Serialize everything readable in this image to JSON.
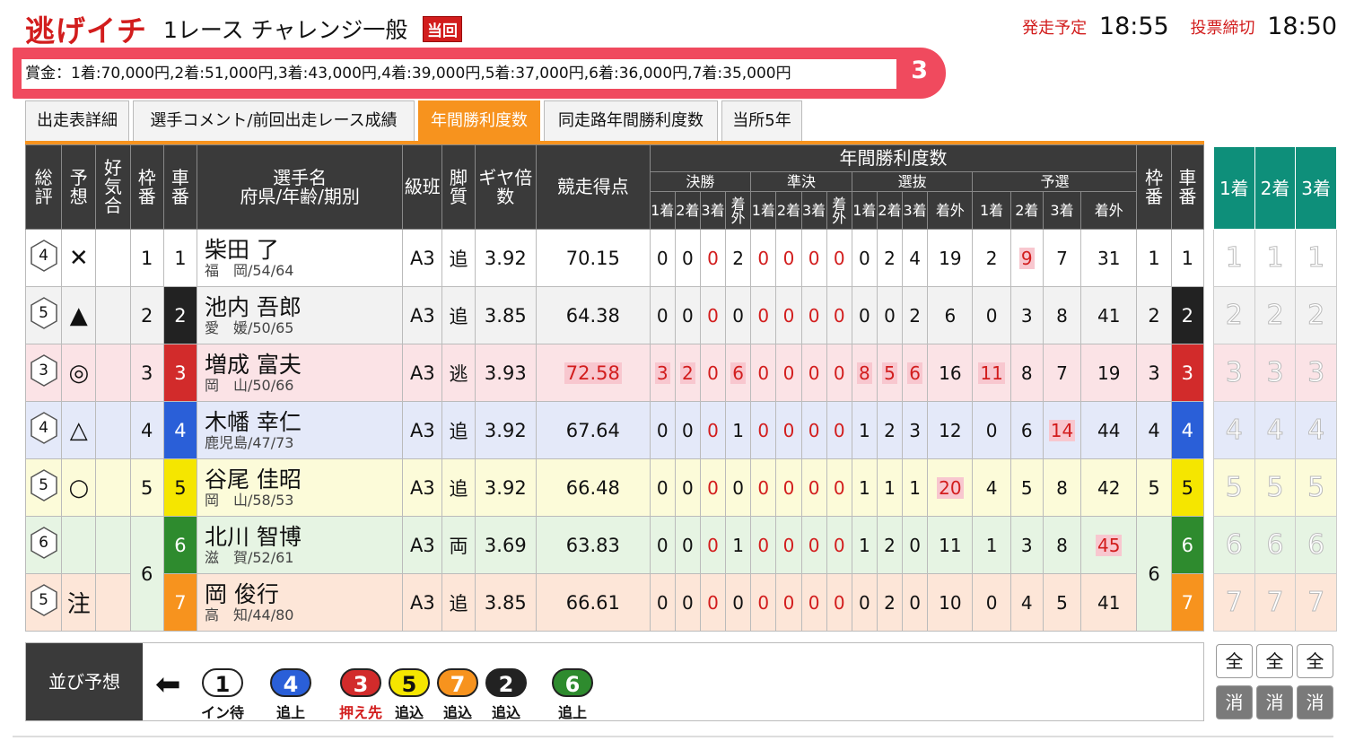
{
  "header": {
    "brand": "逃げイチ",
    "race": "1レース チャレンジ一般",
    "badge": "当回",
    "start_label": "発走予定",
    "start_time": "18:55",
    "close_label": "投票締切",
    "close_time": "18:50"
  },
  "prize": {
    "text": "賞金：1着:70,000円,2着:51,000円,3着:43,000円,4着:39,000円,5着:37,000円,6着:36,000円,7着:35,000円",
    "marker": "3"
  },
  "tabs": [
    "出走表詳細",
    "選手コメント/前回出走レース成績",
    "年間勝利度数",
    "同走路年間勝利度数",
    "当所5年"
  ],
  "table": {
    "headers": {
      "sougou": "総評",
      "yosou": "予想",
      "koukiai": "好気合",
      "waku": "枠番",
      "sha": "車番",
      "name1": "選手名",
      "name2": "府県/年齢/期別",
      "kyu": "級班",
      "kyaku": "脚質",
      "gear": "ギヤ倍数",
      "score": "競走得点",
      "annual": "年間勝利度数",
      "kessho": "決勝",
      "junketsu": "準決",
      "senbatsu": "選抜",
      "yosen": "予選",
      "p1": "1着",
      "p2": "2着",
      "p3": "3着",
      "pout": "着外"
    },
    "rows": [
      {
        "rank": "4",
        "mark": "✕",
        "waku": "1",
        "sha": "1",
        "name": "柴田 了",
        "sub": "福　岡/54/64",
        "kyu": "A3",
        "kyaku": "追",
        "gear": "3.92",
        "score": "70.15",
        "k": [
          "0",
          "0",
          "0",
          "2"
        ],
        "j": [
          "0",
          "0",
          "0",
          "0"
        ],
        "s": [
          "0",
          "2",
          "4",
          "19"
        ],
        "y": [
          "2",
          "9",
          "7",
          "31"
        ]
      },
      {
        "rank": "5",
        "mark": "▲",
        "waku": "2",
        "sha": "2",
        "name": "池内 吾郎",
        "sub": "愛　媛/50/65",
        "kyu": "A3",
        "kyaku": "追",
        "gear": "3.85",
        "score": "64.38",
        "k": [
          "0",
          "0",
          "0",
          "0"
        ],
        "j": [
          "0",
          "0",
          "0",
          "0"
        ],
        "s": [
          "0",
          "0",
          "2",
          "6"
        ],
        "y": [
          "0",
          "3",
          "8",
          "41"
        ]
      },
      {
        "rank": "3",
        "mark": "◎",
        "waku": "3",
        "sha": "3",
        "name": "増成 富夫",
        "sub": "岡　山/50/66",
        "kyu": "A3",
        "kyaku": "逃",
        "gear": "3.93",
        "score": "72.58",
        "k": [
          "3",
          "2",
          "0",
          "6"
        ],
        "j": [
          "0",
          "0",
          "0",
          "0"
        ],
        "s": [
          "8",
          "5",
          "6",
          "16"
        ],
        "y": [
          "11",
          "8",
          "7",
          "19"
        ]
      },
      {
        "rank": "4",
        "mark": "△",
        "waku": "4",
        "sha": "4",
        "name": "木幡 幸仁",
        "sub": "鹿児島/47/73",
        "kyu": "A3",
        "kyaku": "追",
        "gear": "3.92",
        "score": "67.64",
        "k": [
          "0",
          "0",
          "0",
          "1"
        ],
        "j": [
          "0",
          "0",
          "0",
          "0"
        ],
        "s": [
          "1",
          "2",
          "3",
          "12"
        ],
        "y": [
          "0",
          "6",
          "14",
          "44"
        ]
      },
      {
        "rank": "5",
        "mark": "○",
        "waku": "5",
        "sha": "5",
        "name": "谷尾 佳昭",
        "sub": "岡　山/58/53",
        "kyu": "A3",
        "kyaku": "追",
        "gear": "3.92",
        "score": "66.48",
        "k": [
          "0",
          "0",
          "0",
          "0"
        ],
        "j": [
          "0",
          "0",
          "0",
          "0"
        ],
        "s": [
          "1",
          "1",
          "1",
          "20"
        ],
        "y": [
          "4",
          "5",
          "8",
          "42"
        ]
      },
      {
        "rank": "6",
        "mark": "",
        "waku": "6",
        "sha": "6",
        "name": "北川 智博",
        "sub": "滋　賀/52/61",
        "kyu": "A3",
        "kyaku": "両",
        "gear": "3.69",
        "score": "63.83",
        "k": [
          "0",
          "0",
          "0",
          "1"
        ],
        "j": [
          "0",
          "0",
          "0",
          "0"
        ],
        "s": [
          "1",
          "2",
          "0",
          "11"
        ],
        "y": [
          "1",
          "3",
          "8",
          "45"
        ]
      },
      {
        "rank": "5",
        "mark": "注",
        "waku": "",
        "sha": "7",
        "name": "岡 俊行",
        "sub": "高　知/44/80",
        "kyu": "A3",
        "kyaku": "追",
        "gear": "3.85",
        "score": "66.61",
        "k": [
          "0",
          "0",
          "0",
          "0"
        ],
        "j": [
          "0",
          "0",
          "0",
          "0"
        ],
        "s": [
          "0",
          "2",
          "0",
          "10"
        ],
        "y": [
          "0",
          "4",
          "5",
          "41"
        ]
      }
    ]
  },
  "bet_headers": [
    "1着",
    "2着",
    "3着"
  ],
  "prediction": {
    "label": "並び予想",
    "chips": [
      {
        "num": "1",
        "label": "イン待"
      },
      {
        "num": "4",
        "label": "追上"
      },
      {
        "num": "3",
        "label": "押え先"
      },
      {
        "num": "5",
        "label": "追込"
      },
      {
        "num": "7",
        "label": "追込"
      },
      {
        "num": "2",
        "label": "追込"
      },
      {
        "num": "6",
        "label": "追上"
      }
    ]
  },
  "buttons": {
    "all": "全",
    "clear": "消"
  },
  "colors": {
    "brand_red": "#d21d1d",
    "tab_orange": "#f7931e",
    "bet_green": "#0e8f7a",
    "car1": "#ffffff",
    "car2": "#222222",
    "car3": "#d22b2b",
    "car4": "#2a5fd8",
    "car5": "#f5e600",
    "car6": "#2e8b2e",
    "car7": "#f7931e"
  }
}
